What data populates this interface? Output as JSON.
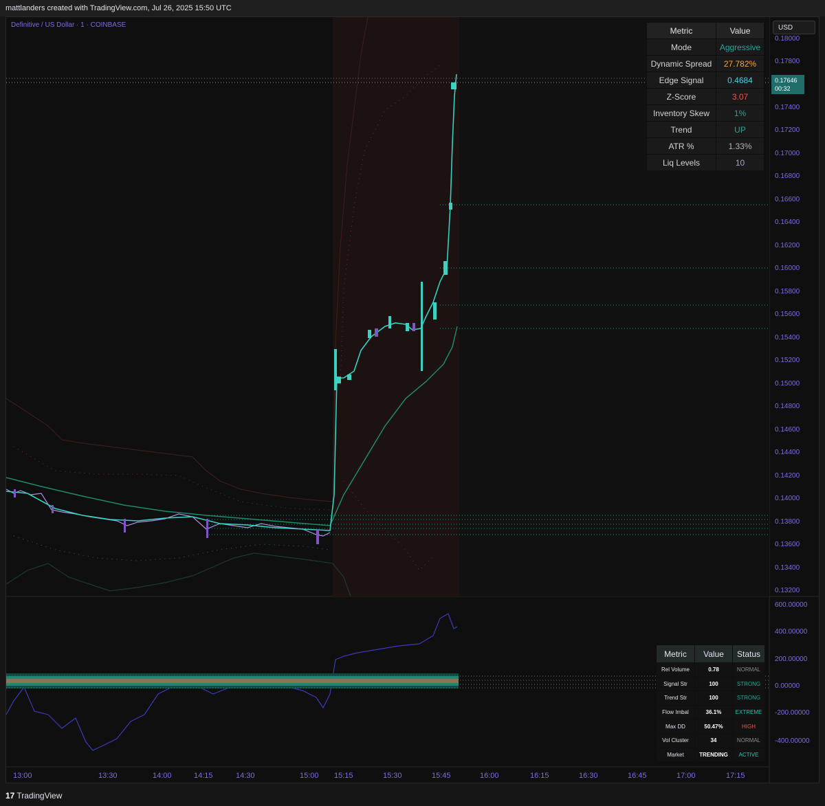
{
  "header": {
    "attribution": "mattlanders created with TradingView.com, Jul 26, 2025 15:50 UTC"
  },
  "symbol": {
    "name": "Definitive",
    "quote": "US Dollar",
    "interval": "1",
    "exchange": "COINBASE",
    "separator1": " / ",
    "separator2": " · "
  },
  "currency_button": "USD",
  "last_price_tag": {
    "price": "0.17646",
    "countdown": "00:32"
  },
  "price_axis": [
    "0.18000",
    "0.17800",
    "0.17400",
    "0.17200",
    "0.17000",
    "0.16800",
    "0.16600",
    "0.16400",
    "0.16200",
    "0.16000",
    "0.15800",
    "0.15600",
    "0.15400",
    "0.15200",
    "0.15000",
    "0.14800",
    "0.14600",
    "0.14400",
    "0.14200",
    "0.14000",
    "0.13800",
    "0.13600",
    "0.13400",
    "0.13200"
  ],
  "osc_axis": [
    "600.00000",
    "400.00000",
    "200.00000",
    "0.00000",
    "-200.00000",
    "-400.00000"
  ],
  "time_axis": [
    "13:00",
    "13:30",
    "14:00",
    "14:15",
    "14:30",
    "15:00",
    "15:15",
    "15:30",
    "15:45",
    "16:00",
    "16:15",
    "16:30",
    "16:45",
    "17:00",
    "17:15"
  ],
  "metrics_table": {
    "headers": [
      "Metric",
      "Value"
    ],
    "rows": [
      {
        "metric": "Mode",
        "value": "Aggressive",
        "color": "#26a69a"
      },
      {
        "metric": "Dynamic Spread",
        "value": "27.782%",
        "color": "#f7a440"
      },
      {
        "metric": "Edge Signal",
        "value": "0.4684",
        "color": "#4dd0e1"
      },
      {
        "metric": "Z-Score",
        "value": "3.07",
        "color": "#ef5350"
      },
      {
        "metric": "Inventory Skew",
        "value": "1%",
        "color": "#26a69a"
      },
      {
        "metric": "Trend",
        "value": "UP",
        "color": "#26a69a"
      },
      {
        "metric": "ATR %",
        "value": "1.33%",
        "color": "#b0b3bb"
      },
      {
        "metric": "Liq Levels",
        "value": "10",
        "color": "#b39ddb"
      }
    ]
  },
  "status_table": {
    "headers": [
      "Metric",
      "Value",
      "Status"
    ],
    "rows": [
      {
        "metric": "Rel Volume",
        "value": "0.78",
        "status": "NORMAL",
        "color": "#8a8d93"
      },
      {
        "metric": "Signal Str",
        "value": "100",
        "status": "STRONG",
        "color": "#26a69a"
      },
      {
        "metric": "Trend Str",
        "value": "100",
        "status": "STRONG",
        "color": "#26a69a"
      },
      {
        "metric": "Flow Imbal",
        "value": "36.1%",
        "status": "EXTREME",
        "color": "#26c6b0"
      },
      {
        "metric": "Max DD",
        "value": "50.47%",
        "status": "HIGH",
        "color": "#ef5350"
      },
      {
        "metric": "Vol Cluster",
        "value": "34",
        "status": "NORMAL",
        "color": "#8a8d93"
      },
      {
        "metric": "Market",
        "value": "TRENDING",
        "status": "ACTIVE",
        "color": "#26c6b0"
      }
    ]
  },
  "footer": {
    "brand": "TradingView",
    "logo": "17"
  },
  "colors": {
    "accent": "#26a69a",
    "candle_body": "#7e57c2",
    "axis_text": "#7b6ee0"
  }
}
